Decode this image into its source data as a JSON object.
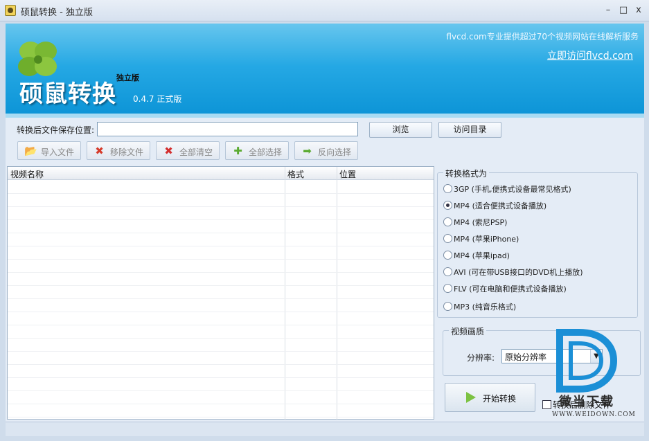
{
  "window": {
    "title": "硕鼠转换 - 独立版",
    "minimize_glyph": "–",
    "maximize_glyph": "□",
    "close_glyph": "x"
  },
  "banner": {
    "brand": "硕鼠转换",
    "edition": "独立版",
    "version": "0.4.7  正式版",
    "slogan": "flvcd.com专业提供超过70个视频网站在线解析服务",
    "visit_link": "立即访问flvcd.com"
  },
  "save_path": {
    "label": "转换后文件保存位置:",
    "value": "",
    "browse_label": "浏览",
    "open_dir_label": "访问目录"
  },
  "toolbar": [
    {
      "name": "import-file-button",
      "icon": "folder-add-icon",
      "label": "导入文件",
      "glyph": "📂",
      "color": "#6b8e3a"
    },
    {
      "name": "remove-file-button",
      "icon": "folder-remove-icon",
      "label": "移除文件",
      "glyph": "✖",
      "color": "#d63b2b"
    },
    {
      "name": "clear-all-button",
      "icon": "red-x-icon",
      "label": "全部清空",
      "glyph": "✖",
      "color": "#d32f2f"
    },
    {
      "name": "select-all-button",
      "icon": "green-plus-icon",
      "label": "全部选择",
      "glyph": "✚",
      "color": "#5bab32"
    },
    {
      "name": "invert-select-button",
      "icon": "green-arrow-icon",
      "label": "反向选择",
      "glyph": "➡",
      "color": "#5bab32"
    }
  ],
  "file_list": {
    "columns": [
      "视频名称",
      "格式",
      "位置"
    ],
    "rows": []
  },
  "format_group": {
    "title": "转换格式为",
    "options": [
      {
        "label": "3GP  (手机,便携式设备最常见格式)",
        "checked": false
      },
      {
        "label": "MP4  (适合便携式设备播放)",
        "checked": true
      },
      {
        "label": "MP4  (索尼PSP)",
        "checked": false
      },
      {
        "label": "MP4  (苹果iPhone)",
        "checked": false
      },
      {
        "label": "MP4  (苹果ipad)",
        "checked": false
      },
      {
        "label": "AVI  (可在带USB接口的DVD机上播放)",
        "checked": false
      },
      {
        "label": "FLV  (可在电脑和便携式设备播放)",
        "checked": false
      },
      {
        "label": "MP3  (纯音乐格式)",
        "checked": false
      }
    ]
  },
  "quality_group": {
    "title": "视频画质",
    "resolution_label": "分辨率:",
    "resolution_value": "原始分辨率"
  },
  "actions": {
    "start_label": "开始转换",
    "delete_after_label": "转换后删除文件",
    "delete_after_checked": false
  },
  "watermark": {
    "text": "微当下载",
    "url": "WWW.WEIDOWN.COM"
  }
}
